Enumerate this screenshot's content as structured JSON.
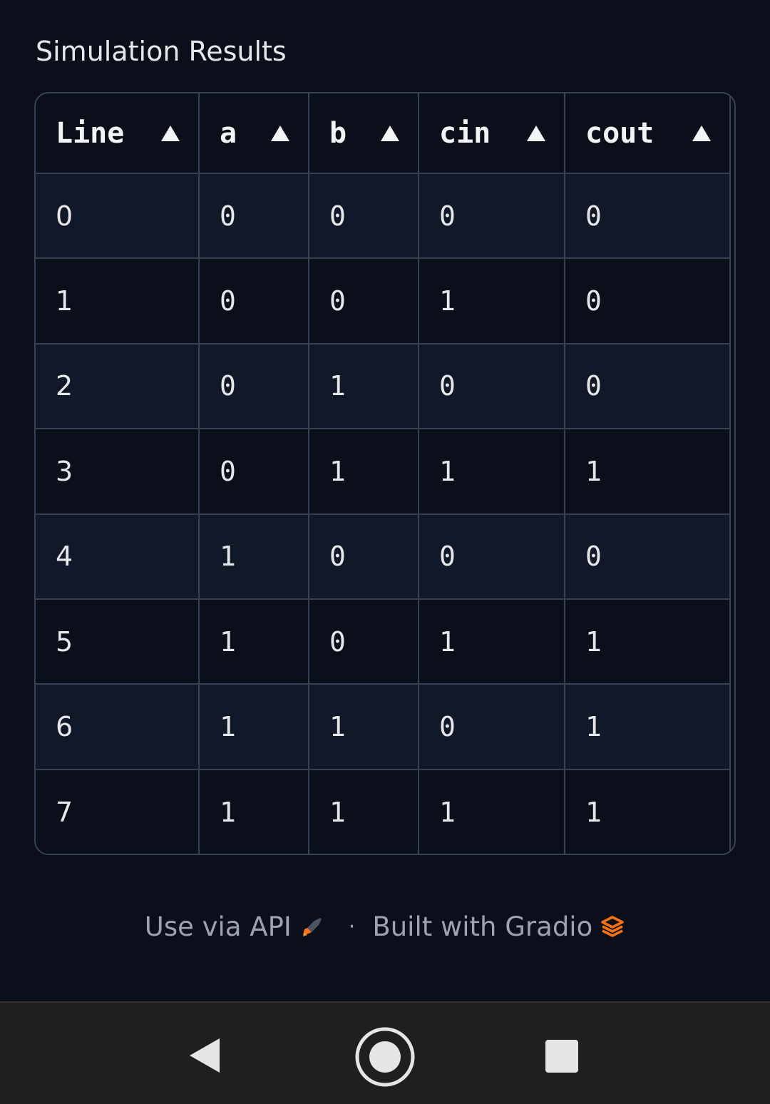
{
  "header": {
    "title": "Simulation Results"
  },
  "table": {
    "columns": [
      {
        "label": "Line",
        "sort_icon": "sort-ascending-icon"
      },
      {
        "label": "a",
        "sort_icon": "sort-ascending-icon"
      },
      {
        "label": "b",
        "sort_icon": "sort-ascending-icon"
      },
      {
        "label": "cin",
        "sort_icon": "sort-ascending-icon"
      },
      {
        "label": "cout",
        "sort_icon": "sort-ascending-icon"
      }
    ],
    "rows": [
      [
        "0",
        "0",
        "0",
        "0",
        "0"
      ],
      [
        "1",
        "0",
        "0",
        "1",
        "0"
      ],
      [
        "2",
        "0",
        "1",
        "0",
        "0"
      ],
      [
        "3",
        "0",
        "1",
        "1",
        "1"
      ],
      [
        "4",
        "1",
        "0",
        "0",
        "0"
      ],
      [
        "5",
        "1",
        "0",
        "1",
        "1"
      ],
      [
        "6",
        "1",
        "1",
        "0",
        "1"
      ],
      [
        "7",
        "1",
        "1",
        "1",
        "1"
      ]
    ]
  },
  "footer": {
    "api_label": "Use via API",
    "api_icon": "rocket-icon",
    "separator": "·",
    "built_label": "Built with Gradio",
    "gradio_icon": "gradio-logo-icon",
    "accent_color": "#f97316"
  },
  "navbar": {
    "back_icon": "back-triangle-icon",
    "home_icon": "home-circle-icon",
    "recents_icon": "recents-square-icon"
  }
}
